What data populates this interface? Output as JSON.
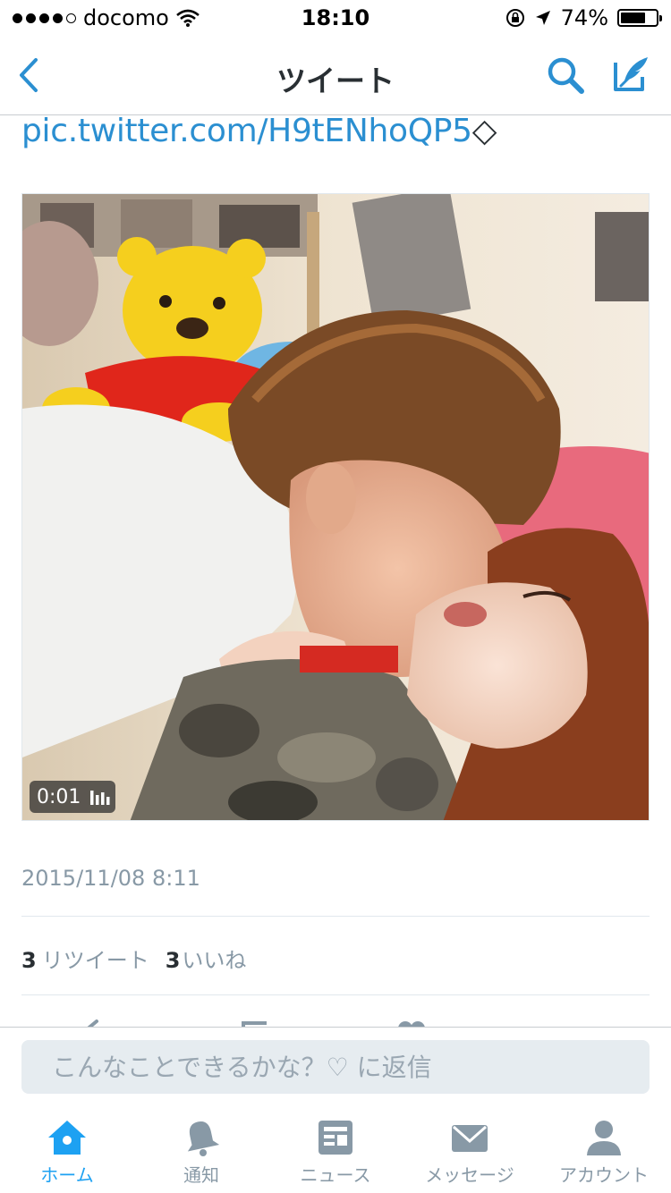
{
  "status_bar": {
    "carrier": "docomo",
    "time": "18:10",
    "battery": "74%",
    "battery_level": 0.74,
    "signal_dots_filled": 4,
    "icons": [
      "wifi-icon",
      "rotation-lock-icon",
      "location-arrow-icon",
      "battery-icon"
    ]
  },
  "nav": {
    "title": "ツイート",
    "icons": [
      "back-chevron-icon",
      "search-icon",
      "compose-tweet-icon"
    ],
    "accent": "#2b8fd1"
  },
  "tweet": {
    "link": "pic.twitter.com/H9tENhoQP5",
    "video_duration": "0:01",
    "timestamp": "2015/11/08 8:11",
    "retweet_count": "3",
    "retweet_label": "リツイート",
    "like_count": "3",
    "like_label": "いいね"
  },
  "reply": {
    "placeholder": "こんなことできるかな？♡ に返信"
  },
  "tabbar": {
    "tabs": [
      {
        "label": "ホーム",
        "icon": "home-icon",
        "active": true
      },
      {
        "label": "通知",
        "icon": "bell-icon",
        "active": false
      },
      {
        "label": "ニュース",
        "icon": "news-icon",
        "active": false
      },
      {
        "label": "メッセージ",
        "icon": "envelope-icon",
        "active": false
      },
      {
        "label": "アカウント",
        "icon": "person-icon",
        "active": false
      }
    ],
    "active_color": "#1da1f2",
    "inactive_color": "#8899a6"
  }
}
